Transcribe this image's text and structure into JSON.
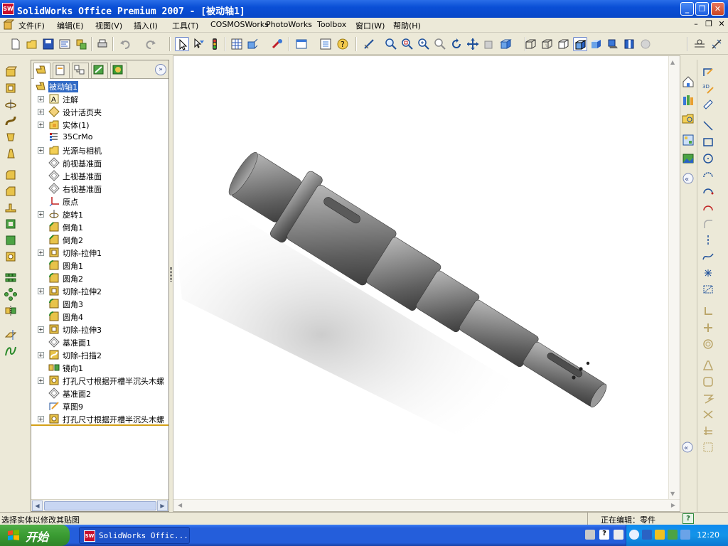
{
  "window": {
    "title": "SolidWorks Office Premium 2007 - [被动轴1]",
    "app_icon_text": "SW",
    "minimize": "_",
    "restore": "❐",
    "close": "✕"
  },
  "menu": {
    "items": [
      "文件(F)",
      "编辑(E)",
      "视图(V)",
      "插入(I)",
      "工具(T)",
      "COSMOSWorks",
      "PhotoWorks",
      "Toolbox",
      "窗口(W)",
      "帮助(H)"
    ],
    "doc_controls": [
      "–",
      "❐",
      "✕"
    ]
  },
  "feature_tree": {
    "root": "被动轴1",
    "nodes": [
      {
        "label": "注解",
        "icon": "annotation-icon",
        "expandable": true
      },
      {
        "label": "设计活页夹",
        "icon": "design-binder-icon",
        "expandable": true
      },
      {
        "label": "实体(1)",
        "icon": "solid-bodies-icon",
        "expandable": true
      },
      {
        "label": "35CrMo",
        "icon": "material-icon",
        "expandable": false
      },
      {
        "label": "光源与相机",
        "icon": "lights-camera-icon",
        "expandable": true
      },
      {
        "label": "前视基准面",
        "icon": "plane-icon",
        "expandable": false
      },
      {
        "label": "上视基准面",
        "icon": "plane-icon",
        "expandable": false
      },
      {
        "label": "右视基准面",
        "icon": "plane-icon",
        "expandable": false
      },
      {
        "label": "原点",
        "icon": "origin-icon",
        "expandable": false
      },
      {
        "label": "旋转1",
        "icon": "revolve-icon",
        "expandable": true
      },
      {
        "label": "倒角1",
        "icon": "chamfer-icon",
        "expandable": false
      },
      {
        "label": "倒角2",
        "icon": "chamfer-icon",
        "expandable": false
      },
      {
        "label": "切除-拉伸1",
        "icon": "cut-extrude-icon",
        "expandable": true
      },
      {
        "label": "圆角1",
        "icon": "fillet-icon",
        "expandable": false
      },
      {
        "label": "圆角2",
        "icon": "fillet-icon",
        "expandable": false
      },
      {
        "label": "切除-拉伸2",
        "icon": "cut-extrude-icon",
        "expandable": true
      },
      {
        "label": "圆角3",
        "icon": "fillet-icon",
        "expandable": false
      },
      {
        "label": "圆角4",
        "icon": "fillet-icon",
        "expandable": false
      },
      {
        "label": "切除-拉伸3",
        "icon": "cut-extrude-icon",
        "expandable": true
      },
      {
        "label": "基准面1",
        "icon": "plane-icon",
        "expandable": false
      },
      {
        "label": "切除-扫描2",
        "icon": "cut-sweep-icon",
        "expandable": true
      },
      {
        "label": "镜向1",
        "icon": "mirror-icon",
        "expandable": false
      },
      {
        "label": "打孔尺寸根据开槽半沉头木螺",
        "icon": "hole-wizard-icon",
        "expandable": true
      },
      {
        "label": "基准面2",
        "icon": "plane-icon",
        "expandable": false
      },
      {
        "label": "草图9",
        "icon": "sketch-icon",
        "expandable": false
      },
      {
        "label": "打孔尺寸根据开槽半沉头木螺",
        "icon": "hole-wizard-icon",
        "expandable": true
      }
    ]
  },
  "status": {
    "message": "选择实体以修改其贴图",
    "editing": "正在编辑：零件",
    "help": "?"
  },
  "taskbar": {
    "start": "开始",
    "item": "SolidWorks Offic...",
    "clock": "12:20"
  },
  "colors": {
    "titlebar": "#0a4fd6",
    "selection": "#316ac5",
    "start_green": "#3a9b32"
  }
}
